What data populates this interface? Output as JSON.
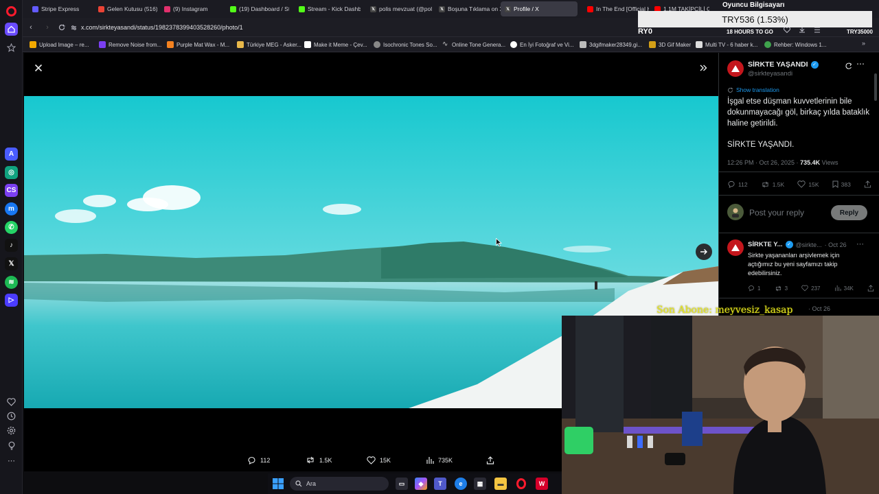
{
  "browser": {
    "tabs": [
      {
        "label": "Stripe Express",
        "color": "#635bff"
      },
      {
        "label": "Gelen Kutusu (516) -",
        "color": "#ea4335"
      },
      {
        "label": "(9) Instagram",
        "color": "#e1306c"
      },
      {
        "label": "(19) Dashboard / Stre",
        "color": "#53fc18"
      },
      {
        "label": "Stream - Kick Dashbo",
        "color": "#53fc18"
      },
      {
        "label": "polis mevzuat (@poli",
        "color": "#444444"
      },
      {
        "label": "Boşuna Tıklama on X",
        "color": "#444444"
      },
      {
        "label": "Profile / X",
        "color": "#444444"
      },
      {
        "label": "In The End [Official H",
        "color": "#ff0000"
      },
      {
        "label": "1.1M TAKİPÇİLİ GLOB",
        "color": "#ff0000"
      }
    ],
    "url": "x.com/sirkteyasandi/status/1982378399403528260/photo/1",
    "bookmarks": [
      {
        "label": "Upload Image – re...",
        "color": "#f2a900"
      },
      {
        "label": "Remove Noise from...",
        "color": "#7b3ff2"
      },
      {
        "label": "Purple Mat Wax - M...",
        "color": "#f58220"
      },
      {
        "label": "Türkiye MEG - Asker...",
        "color": "#e8b84a"
      },
      {
        "label": "Make it Meme - Çev...",
        "color": "#ffffff"
      },
      {
        "label": "Isochronic Tones So...",
        "color": "#888888"
      },
      {
        "label": "Online Tone Genera...",
        "color": "#cccccc"
      },
      {
        "label": "En İyi Fotoğraf ve Vi...",
        "color": "#ffffff"
      },
      {
        "label": "3dgifmaker28349.gi...",
        "color": "#bbbbbb"
      },
      {
        "label": "3D Gif Maker",
        "color": "#d4a017"
      },
      {
        "label": "Multi TV - 6 haber k...",
        "color": "#dddddd"
      },
      {
        "label": "Rehber: Windows 1...",
        "color": "#3fa34d"
      }
    ]
  },
  "overlay": {
    "ticker": "TRY536 (1.53%)",
    "oyuncu": "Oyuncu Bilgisayarı",
    "ry0": "RY0",
    "hours": "18 HOURS TO GO",
    "try35000": "TRY35000",
    "last_sub": "Son Abone: meyvesiz_kasap"
  },
  "viewer": {
    "actions": {
      "replies": "112",
      "reposts": "1.5K",
      "likes": "15K",
      "views": "735K"
    }
  },
  "tweet": {
    "name": "SİRKTE YAŞANDI",
    "handle": "@sirkteyasandi",
    "show_translation": "Show translation",
    "text": "İşgal etse düşman kuvvetlerinin bile dokunmayacağı göl, birkaç yılda bataklık haline getirildi.",
    "text2": "SİRKTE YAŞANDI.",
    "time": "12:26 PM · Oct 26, 2025 ·",
    "views": "735.4K",
    "views_label": "Views",
    "replies": "112",
    "reposts": "1.5K",
    "likes": "15K",
    "bookmarks": "383",
    "reply_placeholder": "Post your reply",
    "reply_button": "Reply"
  },
  "reply_tweet": {
    "name": "SİRKTE Y...",
    "handle": "@sirkte...",
    "date": "· Oct 26",
    "text": "Sirkte yaşananları arşivlemek için açtığımız bu yeni sayfamızı takip edebilirsiniz.",
    "replies": "1",
    "reposts": "3",
    "likes": "237",
    "views": "34K",
    "next_date": "· Oct 26"
  },
  "taskbar": {
    "search_label": "Ara"
  }
}
